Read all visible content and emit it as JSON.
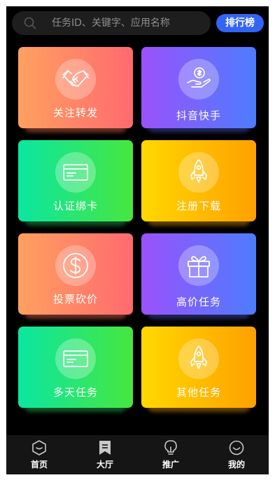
{
  "search": {
    "placeholder": "任务ID、关键字、应用名称"
  },
  "header": {
    "rank_button": "排行榜"
  },
  "cards": [
    {
      "label": "关注转发",
      "icon": "handshake-icon"
    },
    {
      "label": "抖音快手",
      "icon": "hand-coin-icon"
    },
    {
      "label": "认证绑卡",
      "icon": "card-icon"
    },
    {
      "label": "注册下载",
      "icon": "rocket-icon"
    },
    {
      "label": "投票砍价",
      "icon": "dollar-icon"
    },
    {
      "label": "高价任务",
      "icon": "gift-icon"
    },
    {
      "label": "多天任务",
      "icon": "card-icon"
    },
    {
      "label": "其他任务",
      "icon": "rocket-icon"
    }
  ],
  "tabbar": {
    "items": [
      {
        "label": "首页",
        "icon": "hexagon-home-icon"
      },
      {
        "label": "大厅",
        "icon": "bookmark-icon",
        "active": true
      },
      {
        "label": "推广",
        "icon": "lightbulb-icon"
      },
      {
        "label": "我的",
        "icon": "smile-face-icon"
      }
    ]
  },
  "colors": {
    "background": "#000000",
    "accent": "#3464f5",
    "orange_gradient": [
      "#ffa060",
      "#ff6a6f"
    ],
    "purple_gradient": [
      "#9a52fb",
      "#4d7cfe"
    ],
    "green_gradient": [
      "#0be6a2",
      "#47e63f"
    ],
    "yellow_gradient": [
      "#ffd800",
      "#ffa000"
    ]
  }
}
